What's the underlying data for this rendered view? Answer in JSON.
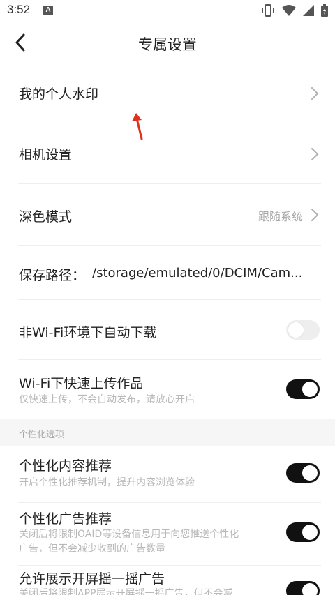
{
  "status_bar": {
    "time": "3:52",
    "notification_badge": "A",
    "icons": [
      "vibrate-icon",
      "wifi-icon",
      "signal-icon",
      "battery-icon"
    ]
  },
  "header": {
    "title": "专属设置",
    "back_icon": "chevron-left-icon"
  },
  "settings": {
    "watermark": {
      "label": "我的个人水印"
    },
    "camera": {
      "label": "相机设置"
    },
    "dark_mode": {
      "label": "深色模式",
      "value": "跟随系统"
    },
    "save_path": {
      "label": "保存路径：",
      "value": "/storage/emulated/0/DCIM/Cam..."
    },
    "non_wifi_download": {
      "label": "非Wi-Fi环境下自动下载",
      "enabled": false
    },
    "wifi_upload": {
      "label": "Wi-Fi下快速上传作品",
      "sub": "仅快速上传，不会自动发布，请放心开启",
      "enabled": true
    }
  },
  "personalization": {
    "section_title": "个性化选项",
    "content_rec": {
      "label": "个性化内容推荐",
      "sub": "开启个性化推荐机制，提升内容浏览体验",
      "enabled": true
    },
    "ad_rec": {
      "label": "个性化广告推荐",
      "sub_line1": "关闭后将限制OAID等设备信息用于向您推送个性化",
      "sub_line2": "广告，但不会减少收到的广告数量",
      "enabled": true
    },
    "shake_ad": {
      "label": "允许展示开屏摇一摇广告",
      "sub": "关闭后将限制APP展示开屏摇一摇广告，但不会减",
      "enabled": true
    }
  },
  "colors": {
    "accent_toggle": "#111111",
    "annotation_arrow": "#e0301e"
  }
}
